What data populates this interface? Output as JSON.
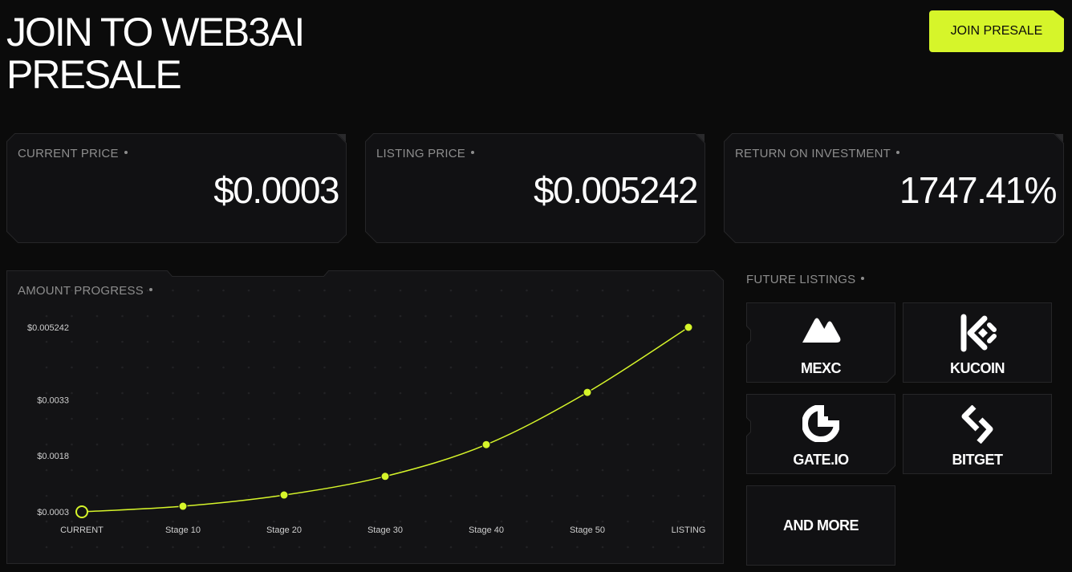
{
  "header": {
    "title_line1": "JOIN TO WEB3AI",
    "title_line2": "PRESALE",
    "join_button": "JOIN PRESALE"
  },
  "stats": [
    {
      "label": "CURRENT PRICE",
      "value": "$0.0003"
    },
    {
      "label": "LISTING PRICE",
      "value": "$0.005242"
    },
    {
      "label": "RETURN ON INVESTMENT",
      "value": "1747.41%"
    }
  ],
  "progress": {
    "label": "AMOUNT PROGRESS"
  },
  "chart_data": {
    "type": "line",
    "categories": [
      "CURRENT",
      "Stage 10",
      "Stage 20",
      "Stage 30",
      "Stage 40",
      "Stage 50",
      "LISTING"
    ],
    "values": [
      0.0003,
      0.00045,
      0.00075,
      0.00125,
      0.0021,
      0.0035,
      0.005242
    ],
    "y_ticks": [
      {
        "value": 0.005242,
        "label": "$0.005242"
      },
      {
        "value": 0.0033,
        "label": "$0.0033"
      },
      {
        "value": 0.0018,
        "label": "$0.0018"
      },
      {
        "value": 0.0003,
        "label": "$0.0003"
      }
    ],
    "ylim": [
      0.0003,
      0.005242
    ],
    "line_color": "#d6f52a",
    "grid": "dots"
  },
  "listings": {
    "label": "FUTURE LISTINGS",
    "items": [
      {
        "name": "MEXC",
        "icon": "mexc-icon"
      },
      {
        "name": "KUCOIN",
        "icon": "kucoin-icon"
      },
      {
        "name": "GATE.IO",
        "icon": "gateio-icon"
      },
      {
        "name": "BITGET",
        "icon": "bitget-icon"
      },
      {
        "name": "AND MORE",
        "icon": ""
      }
    ]
  },
  "colors": {
    "accent": "#d6f52a",
    "background": "#0b0b0b",
    "panel": "#131315",
    "muted_text": "#8d8d8d"
  }
}
